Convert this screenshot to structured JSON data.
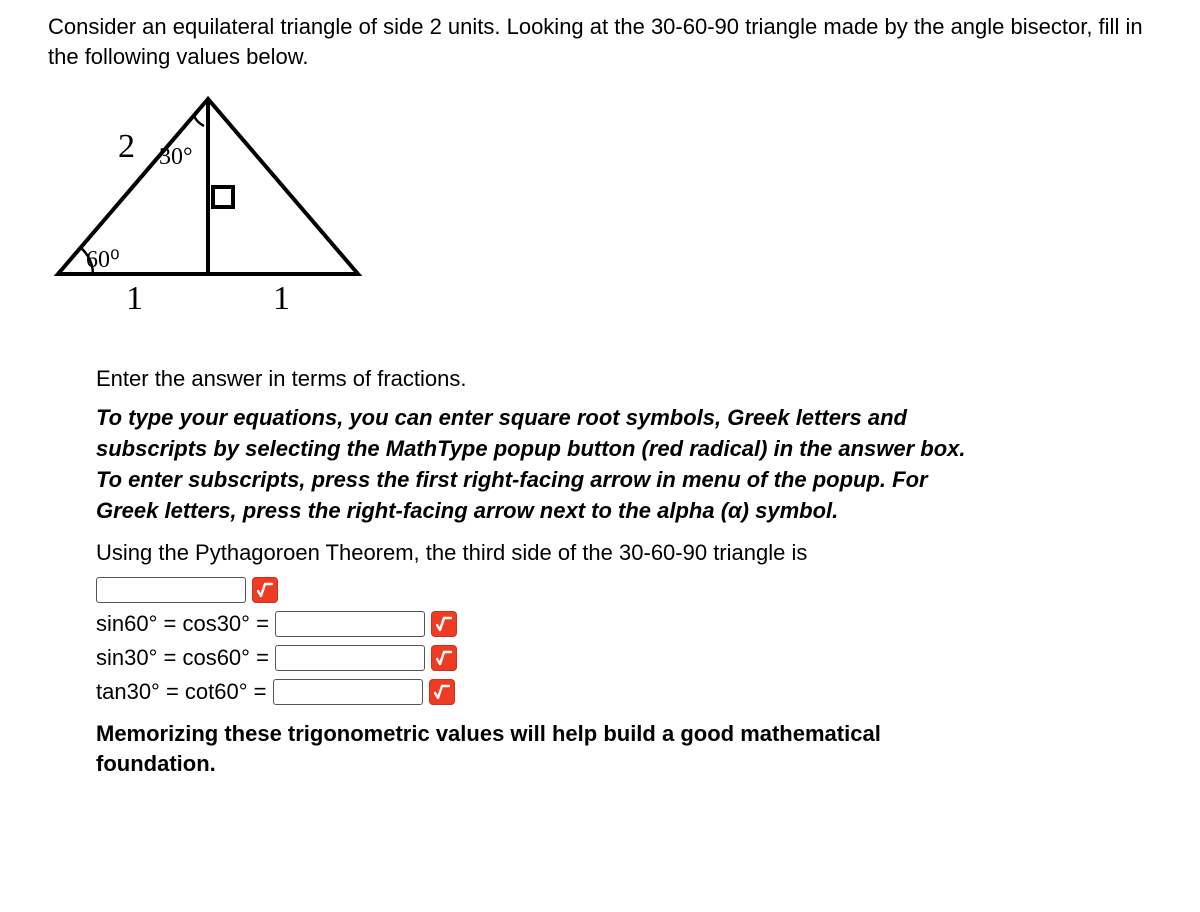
{
  "intro": "Consider an equilateral triangle of side 2 units. Looking at the 30-60-90 triangle made by the angle bisector, fill in the following values below.",
  "diagram": {
    "side_label": "2",
    "top_angle": "30°",
    "base_angle": "60⁰",
    "base_half_left": "1",
    "base_half_right": "1"
  },
  "content": {
    "enter_fractions": "Enter the answer in terms of fractions.",
    "instructions": "To type your equations, you can enter square root symbols, Greek letters and subscripts by selecting the MathType popup button (red radical) in the answer box. To enter subscripts, press the first right-facing arrow in menu of the popup. For Greek letters, press the right-facing arrow next to the alpha (α) symbol.",
    "using_prompt": "Using the Pythagoroen Theorem, the third side of the 30-60-90 triangle is",
    "rows": [
      {
        "label_html": "sin60° = cos30° ="
      },
      {
        "label_html": "sin30° = cos60° ="
      },
      {
        "label_html": "tan30° = cot60° ="
      }
    ],
    "memo": "Memorizing these trigonometric values will help build a good mathematical foundation."
  }
}
